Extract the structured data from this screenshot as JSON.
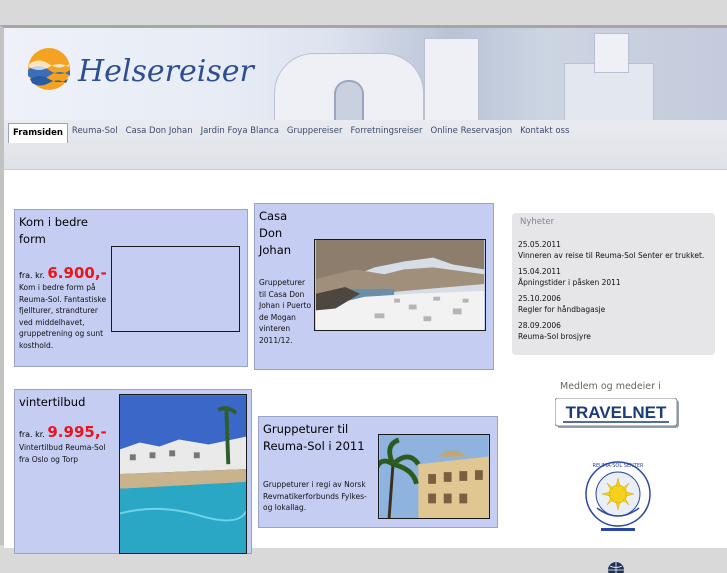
{
  "brand": {
    "name": "Helsereiser"
  },
  "nav": {
    "tabs": [
      {
        "label": "Framsiden",
        "active": true
      },
      {
        "label": "Reuma-Sol"
      },
      {
        "label": "Casa Don Johan"
      },
      {
        "label": "Jardin Foya Blanca"
      },
      {
        "label": "Gruppereiser"
      },
      {
        "label": "Forretningsreiser"
      },
      {
        "label": "Online Reservasjon"
      },
      {
        "label": "Kontakt oss"
      }
    ]
  },
  "promo1": {
    "title": "Kom i bedre form",
    "price_prefix": "fra. kr.",
    "price": "6.900,-",
    "desc": "Kom i bedre form på Reuma-Sol. Fantastiske fjellturer, strandturer ved middelhavet, gruppetrening og sunt kosthold."
  },
  "promo2": {
    "title": "Casa Don Johan",
    "desc": "Gruppeturer til Casa Don Johan i Puerto de Mogan vinteren 2011/12."
  },
  "promo3": {
    "title": "vintertilbud",
    "price_prefix": "fra. kr.",
    "price": "9.995,-",
    "desc": "Vintertilbud Reuma-Sol fra Oslo og Torp"
  },
  "promo4": {
    "title": "Gruppeturer til Reuma-Sol i 2011",
    "desc": "Gruppeturer i regi av Norsk Revmatikerforbunds Fylkes- og lokallag."
  },
  "news": {
    "heading": "Nyheter",
    "items": [
      {
        "date": "25.05.2011",
        "text": "Vinneren av reise til Reuma-Sol Senter er trukket."
      },
      {
        "date": "15.04.2011",
        "text": "Åpningstider i påsken 2011"
      },
      {
        "date": "25.10.2006",
        "text": "Regler for håndbagasje"
      },
      {
        "date": "28.09.2006",
        "text": "Reuma-Sol brosjyre"
      }
    ]
  },
  "members": {
    "label": "Medlem og medeier i",
    "logo_text": "TRAVELNET"
  },
  "seal": {
    "text": "REUMA-SOL SENTER"
  },
  "colors": {
    "box_bg": "#c5cdf2",
    "price_red": "#e8151b",
    "brand_blue": "#2d4f92"
  }
}
